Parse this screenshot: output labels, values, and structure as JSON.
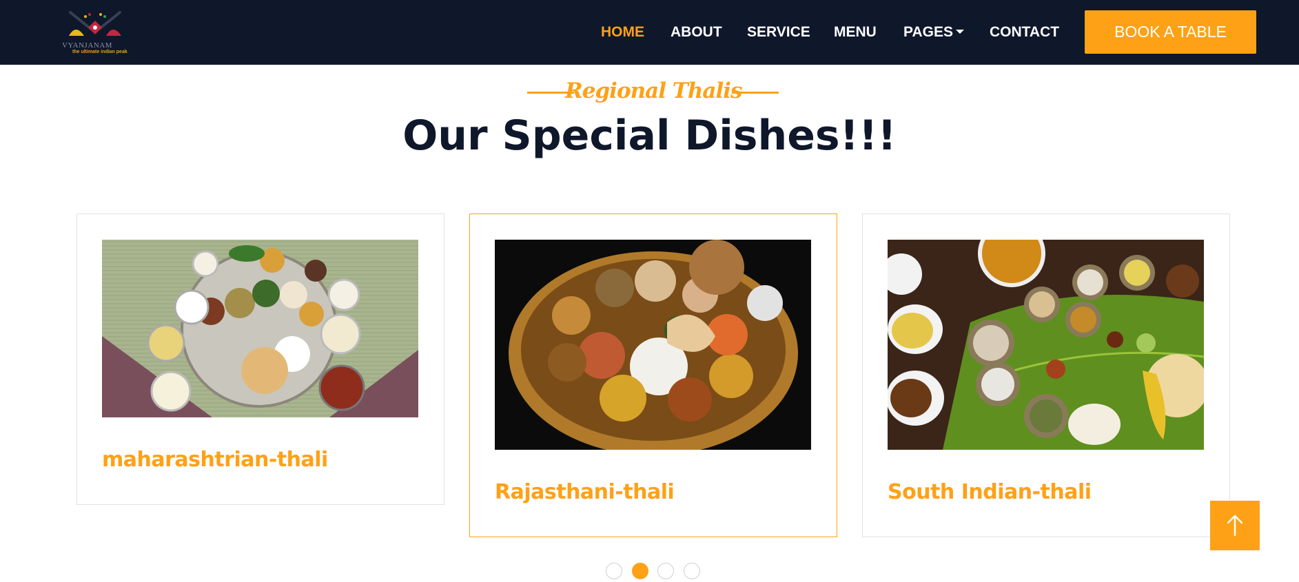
{
  "brand": {
    "name": "VYANJANAM",
    "tagline": "the ultimate indian peak"
  },
  "nav": {
    "items": [
      {
        "label": "HOME",
        "active": true
      },
      {
        "label": "ABOUT",
        "active": false
      },
      {
        "label": "SERVICE",
        "active": false
      },
      {
        "label": "MENU",
        "active": false
      },
      {
        "label": "PAGES",
        "active": false,
        "dropdown": true
      },
      {
        "label": "CONTACT",
        "active": false
      }
    ],
    "cta_label": "BOOK A TABLE"
  },
  "section": {
    "subtitle": "Regional Thalis",
    "title": "Our Special Dishes!!!"
  },
  "cards": [
    {
      "title": "maharashtrian-thali",
      "image": "maharashtrian thali photo",
      "active": false
    },
    {
      "title": "Rajasthani-thali",
      "image": "rajasthani thali photo",
      "active": true
    },
    {
      "title": "South Indian-thali",
      "image": "south indian thali photo",
      "active": false
    }
  ],
  "carousel": {
    "dot_count": 4,
    "active_index": 1
  },
  "icons": {
    "back_to_top": "arrow-up-icon",
    "dropdown": "caret-down-icon"
  },
  "colors": {
    "accent": "#fea116",
    "dark": "#0f172b",
    "white": "#ffffff",
    "border": "#dee2e6"
  }
}
